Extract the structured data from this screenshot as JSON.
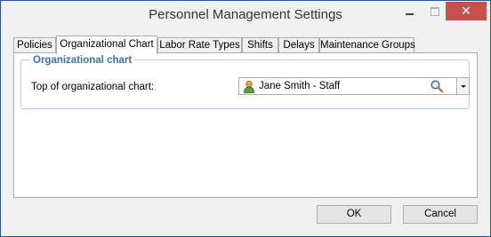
{
  "window": {
    "title": "Personnel Management Settings",
    "minimize_label": "",
    "close_label": "✕"
  },
  "tabs": [
    {
      "label": "Policies"
    },
    {
      "label": "Organizational Chart",
      "active": true
    },
    {
      "label": "Labor Rate Types"
    },
    {
      "label": "Shifts"
    },
    {
      "label": "Delays"
    },
    {
      "label": "Maintenance Groups"
    }
  ],
  "org_chart": {
    "group_title": "Organizational chart",
    "field_label": "Top of organizational chart:",
    "field_value": "Jane Smith - Staff"
  },
  "footer": {
    "ok_label": "OK",
    "cancel_label": "Cancel"
  },
  "colors": {
    "group_title": "#3b6fb6",
    "close_button": "#c7514f",
    "window_border": "#2b579a"
  },
  "icons": {
    "person": "person-icon",
    "search": "magnifier-icon",
    "dropdown": "chevron-down-icon"
  }
}
